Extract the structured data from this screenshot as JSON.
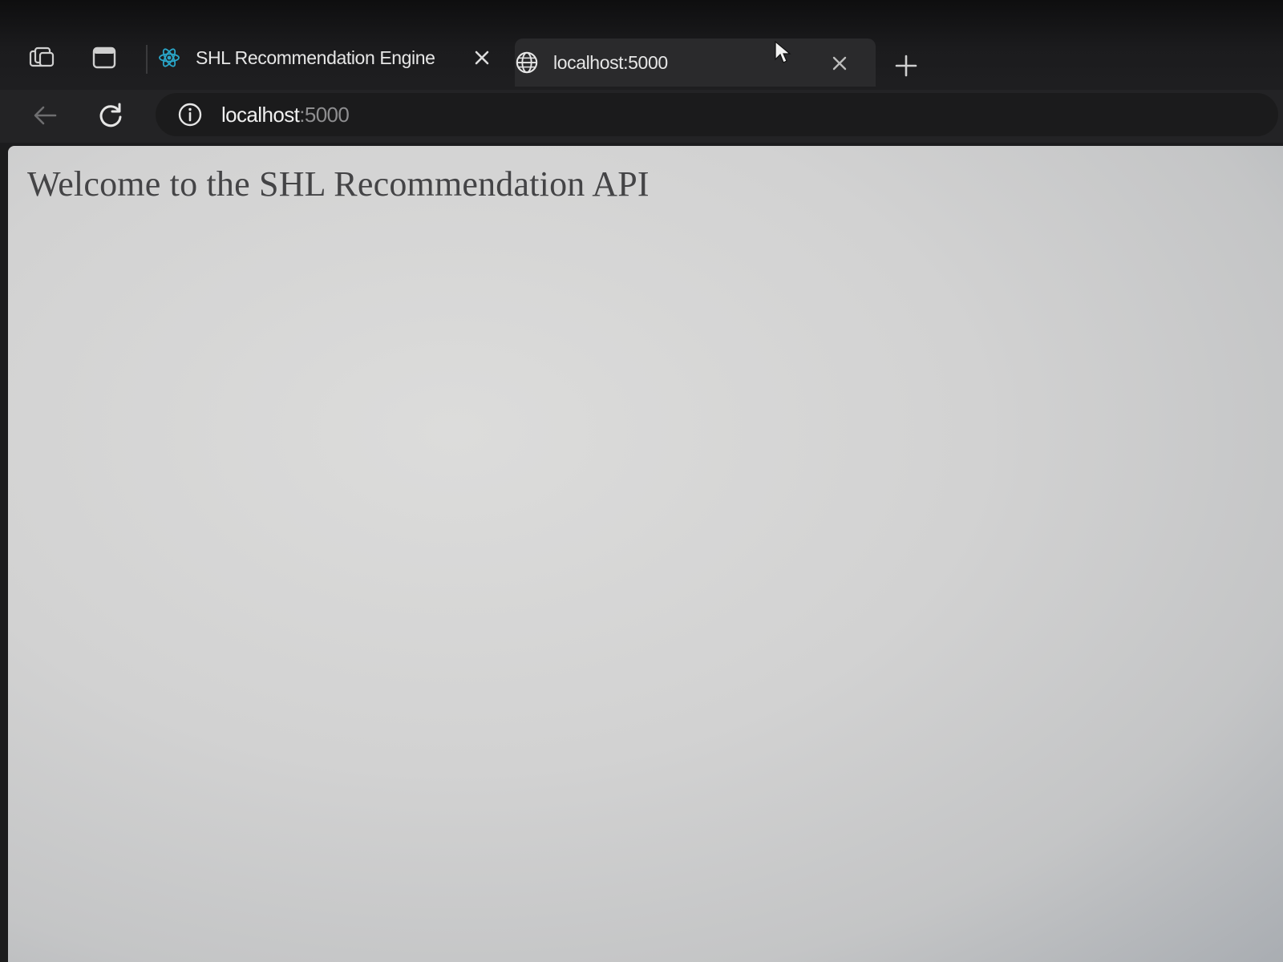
{
  "browser": {
    "tabs": [
      {
        "title": "SHL Recommendation Engine",
        "favicon": "react-atom-icon",
        "active": false
      },
      {
        "title": "localhost:5000",
        "favicon": "globe-icon",
        "active": true
      }
    ],
    "strip_icons": {
      "workspaces": "workspaces-icon",
      "tab_actions": "vertical-tabs-icon",
      "new_tab": "plus-icon"
    },
    "toolbar": {
      "back_icon": "back-arrow-icon",
      "refresh_icon": "refresh-icon",
      "site_info_icon": "info-icon"
    },
    "address": {
      "host": "localhost",
      "port": ":5000"
    }
  },
  "page": {
    "heading": "Welcome to the SHL Recommendation API"
  },
  "colors": {
    "chrome_dark": "#1b1b1d",
    "active_tab": "#2a2a2c",
    "page_background": "#d2d2d2",
    "heading_text": "#444446",
    "react_favicon": "#2aa6c9"
  }
}
